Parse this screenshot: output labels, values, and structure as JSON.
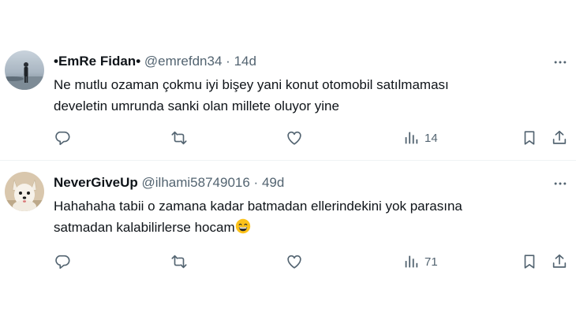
{
  "tweets": [
    {
      "display_name": "•EmRe Fidan•",
      "handle": "@emrefdn34",
      "separator": "·",
      "time": "14d",
      "text_lines": [
        "Ne mutlu ozaman çokmu iyi bişey yani konut otomobil satılmaması",
        "develetin umrunda sanki olan millete oluyor yine"
      ],
      "views": "14"
    },
    {
      "display_name": "NeverGiveUp",
      "handle": "@ilhami58749016",
      "separator": "·",
      "time": "49d",
      "text_lines": [
        "Hahahaha tabii o zamana kadar batmadan ellerindekini yok parasına",
        "satmadan kalabilirlerse hocam"
      ],
      "emoji": "grinning-face-with-smiling-eyes",
      "views": "71"
    }
  ],
  "colors": {
    "text_primary": "#0f1419",
    "text_secondary": "#536471",
    "divider": "#eff3f4"
  },
  "icons": [
    "more-icon",
    "reply-icon",
    "repost-icon",
    "like-icon",
    "views-icon",
    "bookmark-icon",
    "share-icon"
  ]
}
